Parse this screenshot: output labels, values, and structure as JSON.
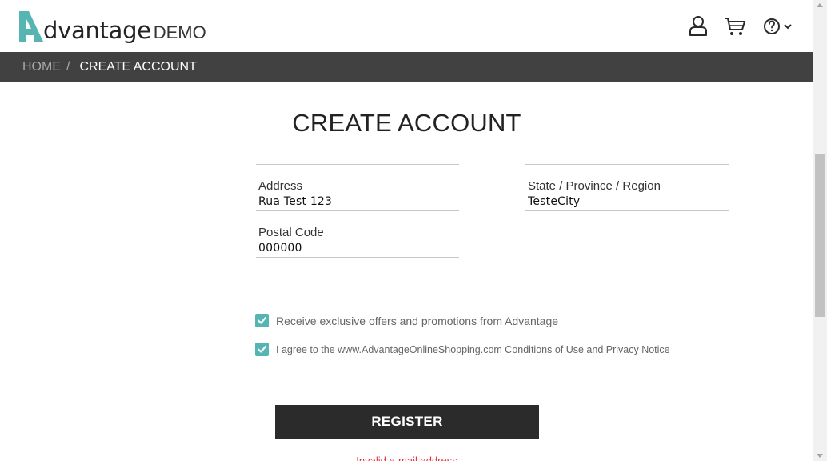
{
  "header": {
    "logo_text": "dvantage",
    "logo_suffix": "DEMO",
    "accent_color": "#54b5b2",
    "icons": [
      "user-icon",
      "cart-icon",
      "help-icon",
      "chevron-down-icon"
    ]
  },
  "breadcrumb": {
    "home": "HOME",
    "separator": "/",
    "current": "CREATE ACCOUNT"
  },
  "page": {
    "title": "CREATE ACCOUNT"
  },
  "form": {
    "address": {
      "label": "Address",
      "value": "Rua Test 123"
    },
    "state": {
      "label": "State / Province / Region",
      "value": "TesteCity"
    },
    "postal_code": {
      "label": "Postal Code",
      "value": "000000"
    }
  },
  "checkboxes": {
    "offers": {
      "label": "Receive exclusive offers and promotions from Advantage",
      "checked": true
    },
    "agree": {
      "label": "I agree to the www.AdvantageOnlineShopping.com Conditions of Use and Privacy Notice",
      "checked": true
    }
  },
  "register_label": "REGISTER",
  "error_message": "Invalid e-mail address"
}
